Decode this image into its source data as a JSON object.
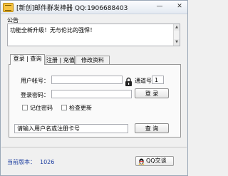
{
  "window": {
    "title": "[新创]邮件群发神器 QQ:1906688403",
    "minimize_glyph": "—",
    "close_glyph": "✕"
  },
  "notice": {
    "label": "公告",
    "text": "功能全新升级！无与伦比的强悍！"
  },
  "tabs": [
    {
      "label": "登录 | 查询",
      "active": true
    },
    {
      "label": "注册 | 充值",
      "active": false
    },
    {
      "label": "修改资料",
      "active": false
    }
  ],
  "login": {
    "account_label": "用户帐号：",
    "account_value": "",
    "password_label": "登录密码：",
    "password_value": "",
    "channel_label": "通道号",
    "channel_value": "1",
    "login_button": "登 录",
    "remember_label": "记住密码",
    "remember_checked": false,
    "check_update_label": "检查更新",
    "check_update_checked": false
  },
  "query": {
    "input_value": "请输入用户名或注册卡号",
    "button": "查 询"
  },
  "footer": {
    "version_label": "当前版本：",
    "version_number": "1026",
    "qq_button": "QQ交谈"
  },
  "icons": {
    "app": "app-icon",
    "lock": "lock-icon",
    "qq": "qq-penguin-icon"
  },
  "colors": {
    "version_text": "#1e3fa0",
    "window_bg": "#f0f0f0"
  }
}
